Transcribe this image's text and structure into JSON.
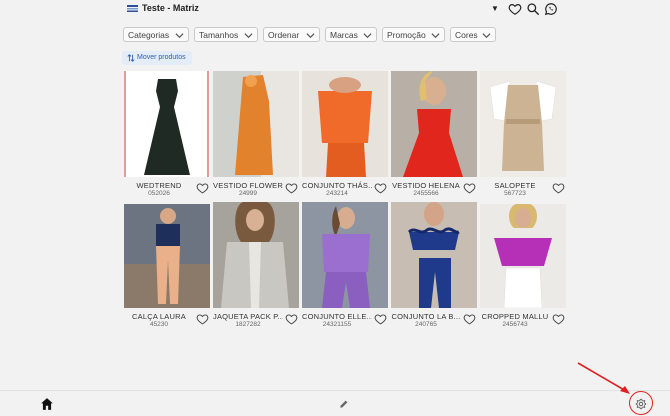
{
  "header": {
    "store_name": "Teste - Matriz",
    "icons": [
      "store-logo-icon",
      "caret-down-icon",
      "heart-icon",
      "search-icon",
      "whatsapp-icon"
    ]
  },
  "filters": [
    {
      "label": "Categorias"
    },
    {
      "label": "Tamanhos"
    },
    {
      "label": "Ordenar"
    },
    {
      "label": "Marcas"
    },
    {
      "label": "Promoção"
    },
    {
      "label": "Cores"
    }
  ],
  "move_button": {
    "label": "Mover produtos",
    "icon": "sort-arrows-icon"
  },
  "products": [
    {
      "name": "WEDTREND",
      "code": "052026",
      "colors": [
        "#ffffff",
        "#1f2a24"
      ]
    },
    {
      "name": "VESTIDO FLOWER",
      "code": "24999",
      "colors": [
        "#cfd2cc",
        "#e2822c"
      ]
    },
    {
      "name": "CONJUNTO THÁS...",
      "code": "243214",
      "colors": [
        "#e7e2dc",
        "#f06a2a"
      ]
    },
    {
      "name": "VESTIDO HELENA",
      "code": "2455566",
      "colors": [
        "#b8b0a6",
        "#e0261d"
      ]
    },
    {
      "name": "SALOPETE",
      "code": "567723",
      "colors": [
        "#efece8",
        "#cbb394"
      ]
    },
    {
      "name": "CALÇA LAURA",
      "code": "45230",
      "colors": [
        "#6b7480",
        "#e9b08a"
      ]
    },
    {
      "name": "JAQUETA PACK P...",
      "code": "1827282",
      "colors": [
        "#a5a39b",
        "#c9c7c1"
      ]
    },
    {
      "name": "CONJUNTO ELLE...",
      "code": "24321155",
      "colors": [
        "#8d95a3",
        "#9a6fcf"
      ]
    },
    {
      "name": "CONJUNTO LA B...",
      "code": "240765",
      "colors": [
        "#c7bdb3",
        "#1f3a8a"
      ]
    },
    {
      "name": "CROPPED MALLU",
      "code": "2456743",
      "colors": [
        "#eceae6",
        "#b52fb7"
      ]
    }
  ],
  "bottom_nav": {
    "icons": [
      "home-icon",
      "pencil-icon",
      "gear-icon"
    ]
  },
  "annotation": {
    "color": "#e02020"
  }
}
